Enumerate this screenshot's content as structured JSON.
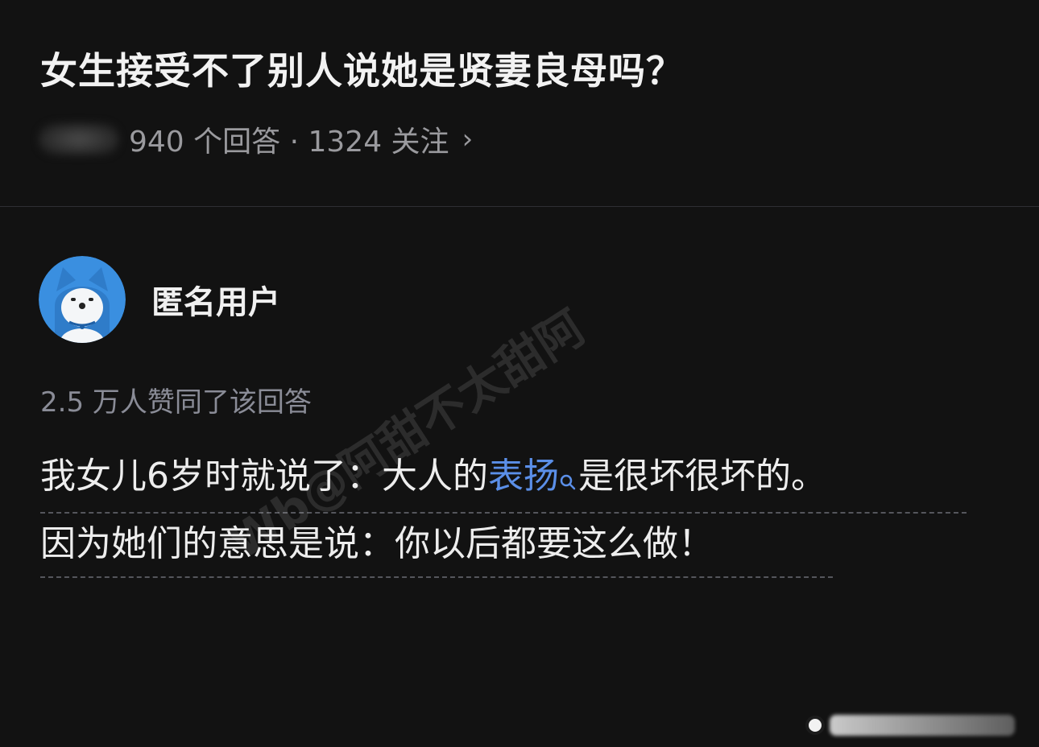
{
  "question": {
    "title": "女生接受不了别人说她是贤妻良母吗？",
    "meta": "940 个回答 · 1324 关注",
    "arrow": "›"
  },
  "answer": {
    "author_name": "匿名用户",
    "avatar_icon": "anonymous-dog-avatar",
    "upvote_text": "2.5 万人赞同了该回答",
    "line1_before": "我女儿6岁时就说了：大人的",
    "line1_link": "表扬",
    "line1_after": "是很坏很坏的。",
    "line2": "因为她们的意思是说：你以后都要这么做！"
  },
  "watermark": {
    "text": "Wb@阿甜不太甜阿"
  },
  "colors": {
    "background": "#121212",
    "link": "#5b8fe8",
    "avatar_blue": "#3a8fe0"
  }
}
